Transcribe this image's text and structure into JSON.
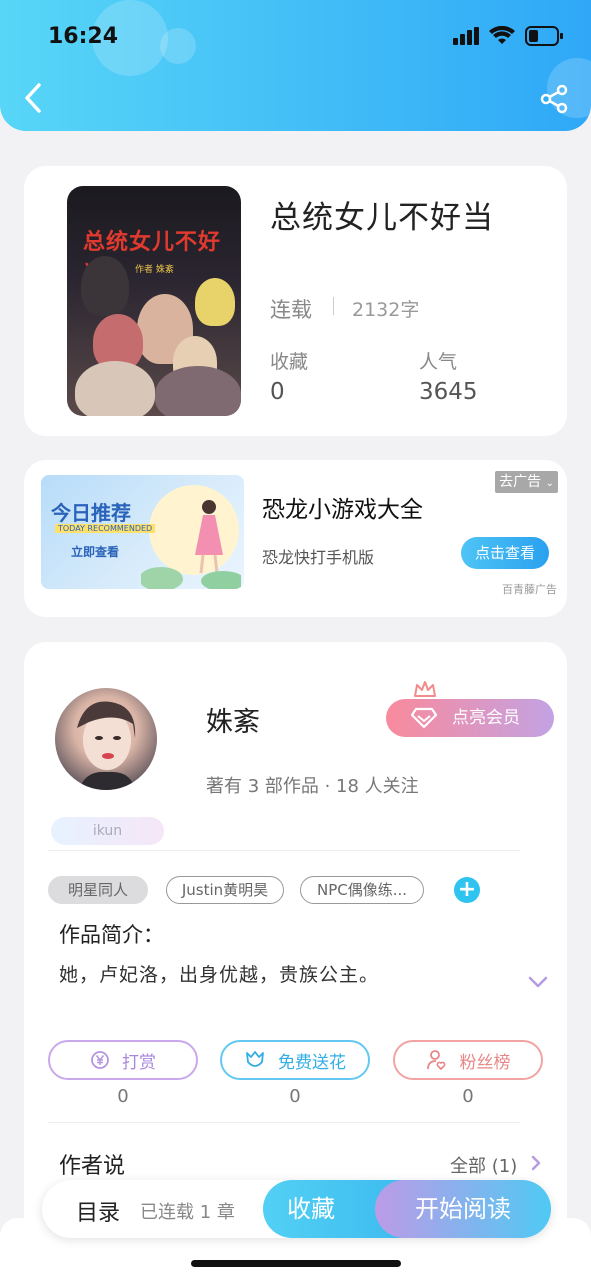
{
  "status_bar": {
    "time": "16:24"
  },
  "book": {
    "cover_title": "总统女儿不好当",
    "cover_subtitle": "作者 姝紊",
    "title": "总统女儿不好当",
    "serial_label": "连载",
    "word_count": "2132字",
    "favorites_label": "收藏",
    "favorites_value": "0",
    "popularity_label": "人气",
    "popularity_value": "3645"
  },
  "ad": {
    "banner_title": "今日推荐",
    "banner_en": "TODAY RECOMMENDED",
    "banner_button": "立即查看",
    "title": "恐龙小游戏大全",
    "subtitle": "恐龙快打手机版",
    "button": "点击查看",
    "close_label": "去广告",
    "source": "百青藤广告"
  },
  "author": {
    "name": "姝紊",
    "stats": "著有 3 部作品 · 18 人关注",
    "vip_button": "点亮会员",
    "badge": "ikun",
    "tags": [
      "明星同人",
      "Justin黄明昊",
      "NPC偶像练..."
    ],
    "add_tag": "+",
    "intro_label": "作品简介：",
    "intro_text": "她，卢妃洛，出身优越，贵族公主。"
  },
  "actions": {
    "reward_label": "打赏",
    "reward_count": "0",
    "flower_label": "免费送花",
    "flower_count": "0",
    "fans_label": "粉丝榜",
    "fans_count": "0"
  },
  "author_says": {
    "label": "作者说",
    "all_link": "全部 (1)"
  },
  "bottom_bar": {
    "toc_label": "目录",
    "toc_status": "已连载 1 章",
    "favorite_button": "收藏",
    "read_button": "开始阅读"
  },
  "colors": {
    "header_start": "#58d6f7",
    "header_end": "#2fa8f7",
    "accent": "#2fc3ef"
  }
}
